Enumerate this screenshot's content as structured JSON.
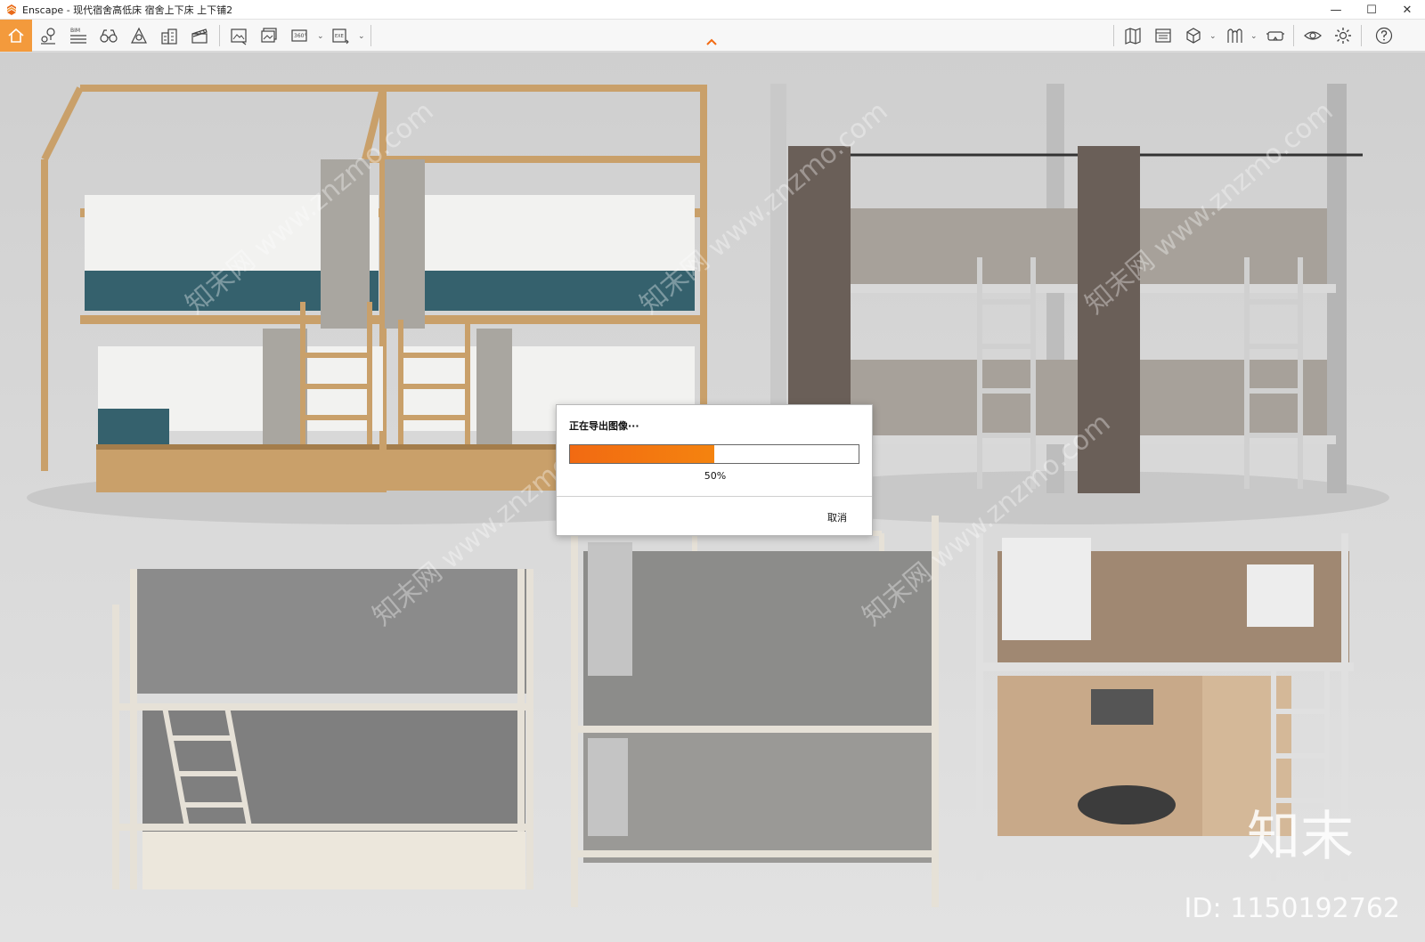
{
  "window": {
    "title": "Enscape - 现代宿舍高低床 宿舍上下床 上下铺2",
    "minimize": "—",
    "maximize": "☐",
    "close": "✕"
  },
  "toolbar": {
    "bim_label": "BIM",
    "icons_left": [
      "home-icon",
      "location-pins-icon",
      "bim-menu-icon",
      "binoculars-icon",
      "sun-shape-icon",
      "buildings-icon",
      "clapperboard-icon",
      "render-image-icon",
      "batch-render-icon",
      "panorama-360-icon",
      "export-exe-icon"
    ],
    "icons_right": [
      "map-icon",
      "window-icon",
      "asset-library-icon",
      "material-icon",
      "vr-headset-icon",
      "visibility-eye-icon",
      "settings-gear-icon",
      "help-icon"
    ],
    "accent": "#f39a3c"
  },
  "dialog": {
    "title": "正在导出图像···",
    "progress_percent": 50,
    "progress_label": "50%",
    "cancel_label": "取消",
    "bar_color": "#f26a12"
  },
  "watermarks": {
    "site": "知末网 www.znzmo.com",
    "brand": "知末",
    "id": "ID: 1150192762"
  }
}
